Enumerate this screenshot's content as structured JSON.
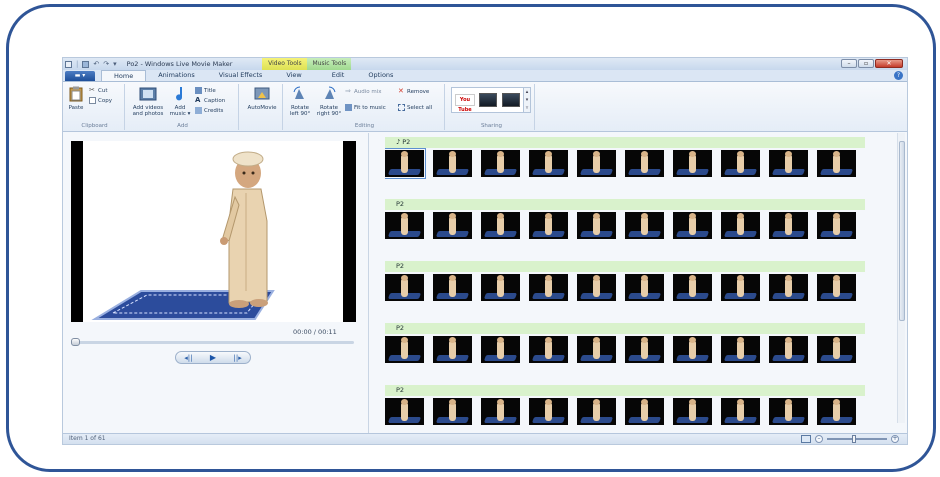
{
  "window": {
    "title": "Po2 - Windows Live Movie Maker",
    "context_video_tools": "Video Tools",
    "context_music_tools": "Music Tools",
    "min_label": "–",
    "max_label": "▫",
    "close_label": "✕"
  },
  "tabs": [
    {
      "label": "Home",
      "active": true
    },
    {
      "label": "Animations",
      "active": false
    },
    {
      "label": "Visual Effects",
      "active": false
    },
    {
      "label": "View",
      "active": false
    },
    {
      "label": "Edit",
      "active": false
    },
    {
      "label": "Options",
      "active": false
    }
  ],
  "ribbon": {
    "clipboard": {
      "label": "Clipboard",
      "paste": "Paste",
      "cut": "Cut",
      "copy": "Copy"
    },
    "add": {
      "label": "Add",
      "add_videos_1": "Add videos",
      "add_videos_2": "and photos",
      "add_music_1": "Add",
      "add_music_2": "music ▾",
      "title": "Title",
      "caption": "Caption",
      "credits": "Credits"
    },
    "automovie": {
      "label": "AutoMovie"
    },
    "editing": {
      "label": "Editing",
      "rotate_left_1": "Rotate",
      "rotate_left_2": "left 90°",
      "rotate_right_1": "Rotate",
      "rotate_right_2": "right 90°",
      "audio_mix": "Audio mix",
      "remove": "Remove",
      "fit_to_music": "Fit to music",
      "select_all": "Select all"
    },
    "sharing": {
      "label": "Sharing",
      "youtube": "You Tube"
    }
  },
  "preview": {
    "time": "00:00 / 00:11",
    "prev_frame": "◂||",
    "play": "▶",
    "next_frame": "||▸",
    "seek_fraction": 0.0
  },
  "storyboard": {
    "rows": [
      {
        "label": "♪ P2",
        "frames": 10
      },
      {
        "label": "P2",
        "frames": 10
      },
      {
        "label": "P2",
        "frames": 10
      },
      {
        "label": "P2",
        "frames": 10
      },
      {
        "label": "P2",
        "frames": 10
      }
    ]
  },
  "status": {
    "text": "Item 1 of 61",
    "zoom_in": "+",
    "zoom_out": "–",
    "zoom_fraction": 0.45
  },
  "colors": {
    "frame_border": "#2f5597",
    "ribbon_bg": "#e5edf7",
    "row_label_bg": "#d9f2cc"
  }
}
